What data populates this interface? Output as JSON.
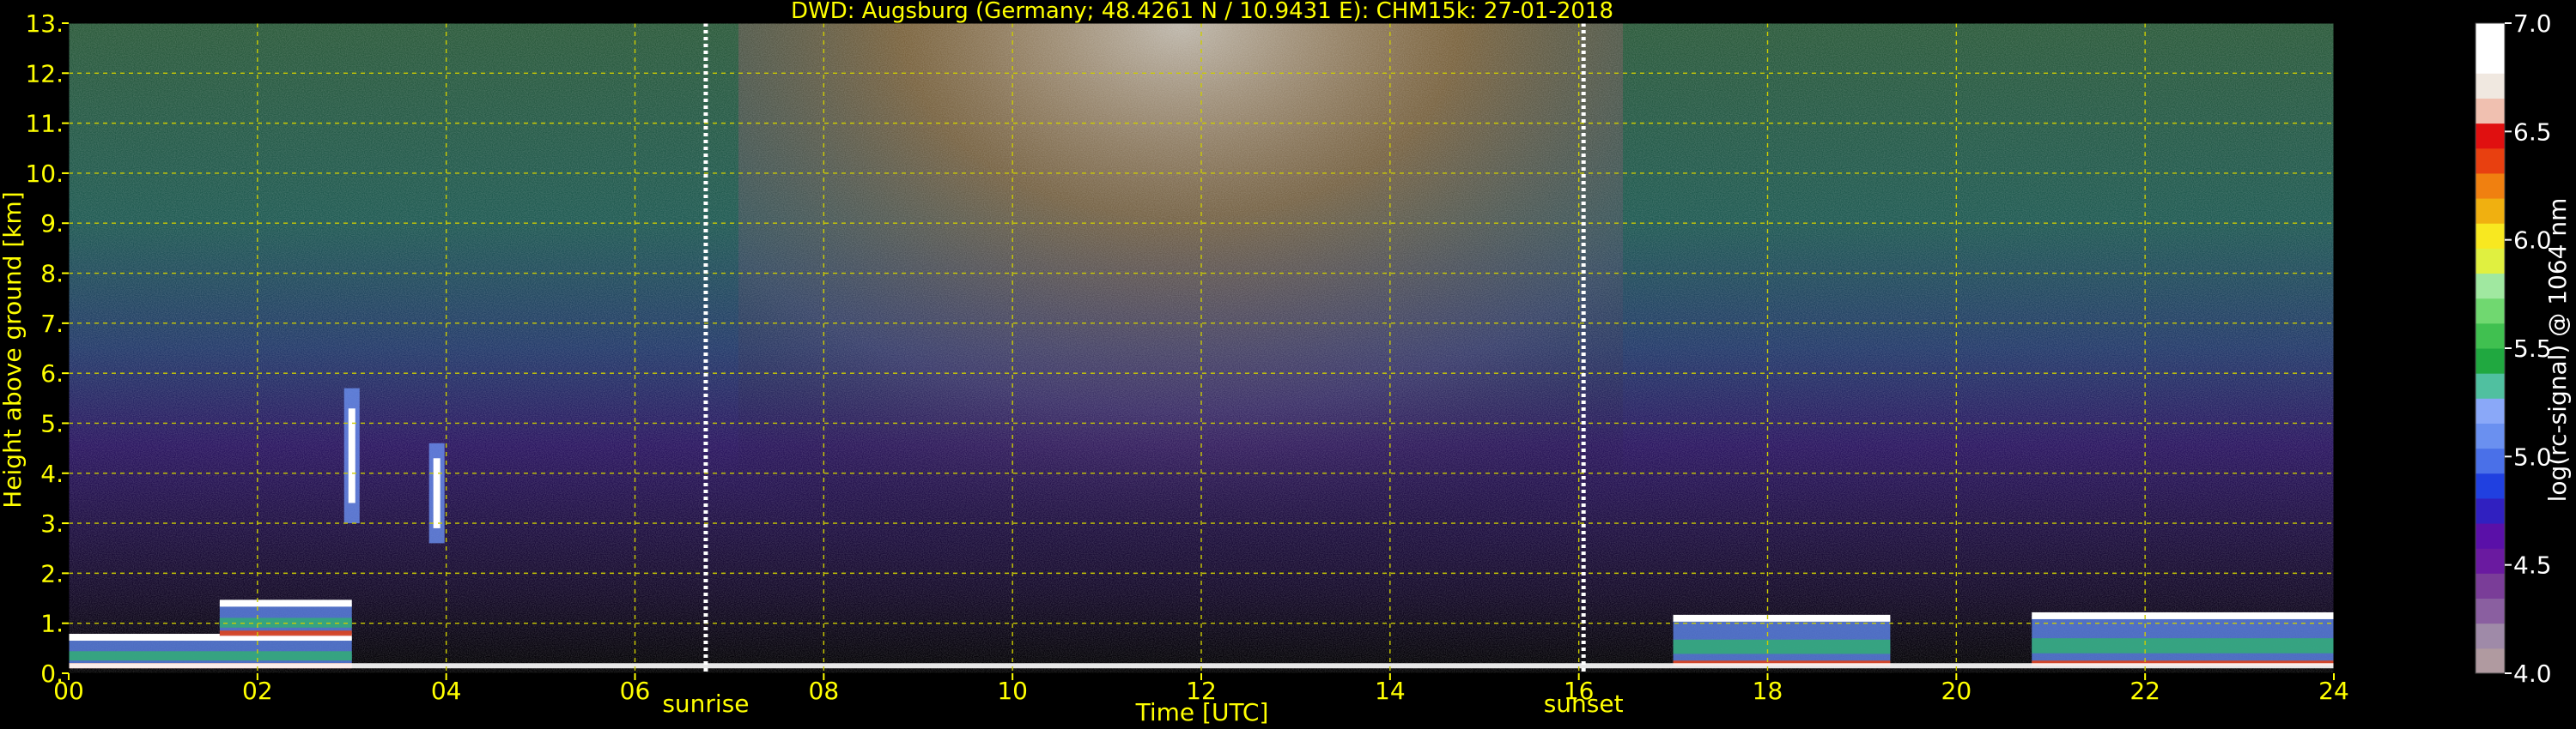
{
  "chart_data": {
    "type": "heatmap",
    "title": "DWD: Augsburg (Germany; 48.4261 N / 10.9431 E):    CHM15k: 27-01-2018",
    "xlabel": "Time [UTC]",
    "ylabel": "Height above ground [km]",
    "colorbar_label": "log(rc-signal) @ 1064 nm",
    "xlim": [
      0,
      24
    ],
    "ylim": [
      0,
      13
    ],
    "x_ticks": [
      0,
      2,
      4,
      6,
      8,
      10,
      12,
      14,
      16,
      18,
      20,
      22,
      24
    ],
    "x_tick_labels": [
      "00",
      "02",
      "04",
      "06",
      "08",
      "10",
      "12",
      "14",
      "16",
      "18",
      "20",
      "22",
      "24"
    ],
    "y_ticks": [
      0,
      1,
      2,
      3,
      4,
      5,
      6,
      7,
      8,
      9,
      10,
      11,
      12,
      13
    ],
    "y_tick_labels": [
      "0.",
      "1.",
      "2.",
      "3.",
      "4.",
      "5.",
      "6.",
      "7.",
      "8.",
      "9.",
      "10.",
      "11.",
      "12.",
      "13."
    ],
    "colorbar_range": [
      4.0,
      7.0
    ],
    "colorbar_ticks": [
      "4.0",
      "4.5",
      "5.0",
      "5.5",
      "6.0",
      "6.5",
      "7.0"
    ],
    "grid": true,
    "annotations": [
      {
        "text": "sunrise",
        "x": 6.75
      },
      {
        "text": "sunset",
        "x": 16.05
      }
    ],
    "cloud_layers": [
      {
        "x0": 0.0,
        "x1": 3.0,
        "y0": 0.1,
        "y1": 0.72
      },
      {
        "x0": 1.6,
        "x1": 3.0,
        "y0": 0.75,
        "y1": 1.4
      },
      {
        "x0": 17.0,
        "x1": 19.3,
        "y0": 0.15,
        "y1": 1.1
      },
      {
        "x0": 20.8,
        "x1": 24.0,
        "y0": 0.15,
        "y1": 1.15
      }
    ],
    "elevated_clouds": [
      {
        "x": 3.0,
        "y0": 3.0,
        "y1": 5.7
      },
      {
        "x": 3.9,
        "y0": 2.6,
        "y1": 4.6
      }
    ]
  },
  "colors": {
    "background": "#000000",
    "text": "#ffff00",
    "grid": "#cccc00",
    "colorbar_text": "#ffffff",
    "colormap": [
      "#b09aa0",
      "#9f8aa8",
      "#8a5fa0",
      "#7a3d98",
      "#6a1aa0",
      "#5a10a8",
      "#3020c0",
      "#2040e0",
      "#4a70e8",
      "#6a90f0",
      "#8aa8f8",
      "#50c0a0",
      "#20a840",
      "#40c050",
      "#70d870",
      "#a0e8a0",
      "#e0f040",
      "#f8e820",
      "#f0b010",
      "#f08010",
      "#e84010",
      "#e01010",
      "#f0c0b0",
      "#f0e8e0",
      "#ffffff",
      "#ffffff"
    ]
  }
}
